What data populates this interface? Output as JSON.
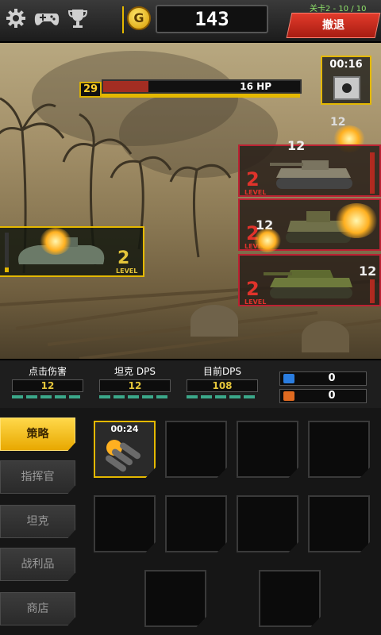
{
  "topbar": {
    "settings_icon": "gear-icon",
    "gamepad_icon": "gamepad-icon",
    "trophy_icon": "trophy-icon",
    "gold_symbol": "G",
    "gold_amount": "143",
    "stage_label": "关卡2 - 10 / 10",
    "retreat_label": "撤退"
  },
  "boss": {
    "level": "29",
    "hp_label": "16 HP",
    "hp_fraction": 0.23
  },
  "crate": {
    "timer": "00:16",
    "icon": "radiation-crate-icon"
  },
  "enemy_tanks": [
    {
      "level": "2",
      "level_caption": "LEVEL",
      "count": "12"
    },
    {
      "level": "2",
      "level_caption": "LEVEL",
      "count": "12"
    },
    {
      "level": "2",
      "level_caption": "LEVEL",
      "count": "12"
    }
  ],
  "floating_damage": "12",
  "player_tank": {
    "level": "2",
    "level_caption": "LEVEL"
  },
  "stats": {
    "click_damage_label": "点击伤害",
    "click_damage_value": "12",
    "tank_dps_label": "坦克 DPS",
    "tank_dps_value": "12",
    "current_dps_label": "目前DPS",
    "current_dps_value": "108",
    "resource1_value": "0",
    "resource2_value": "0"
  },
  "sidebar": {
    "items": [
      {
        "label": "策略",
        "active": true
      },
      {
        "label": "指挥官",
        "active": false
      },
      {
        "label": "坦克",
        "active": false
      },
      {
        "label": "战利品",
        "active": false
      },
      {
        "label": "商店",
        "active": false
      }
    ]
  },
  "slots": {
    "first_timer": "00:24",
    "first_icon": "missile-strike-icon"
  },
  "colors": {
    "accent_gold": "#e4b800",
    "retreat_red": "#d1291c",
    "enemy_red": "#e0332b",
    "stat_teal": "#3ba88a"
  }
}
